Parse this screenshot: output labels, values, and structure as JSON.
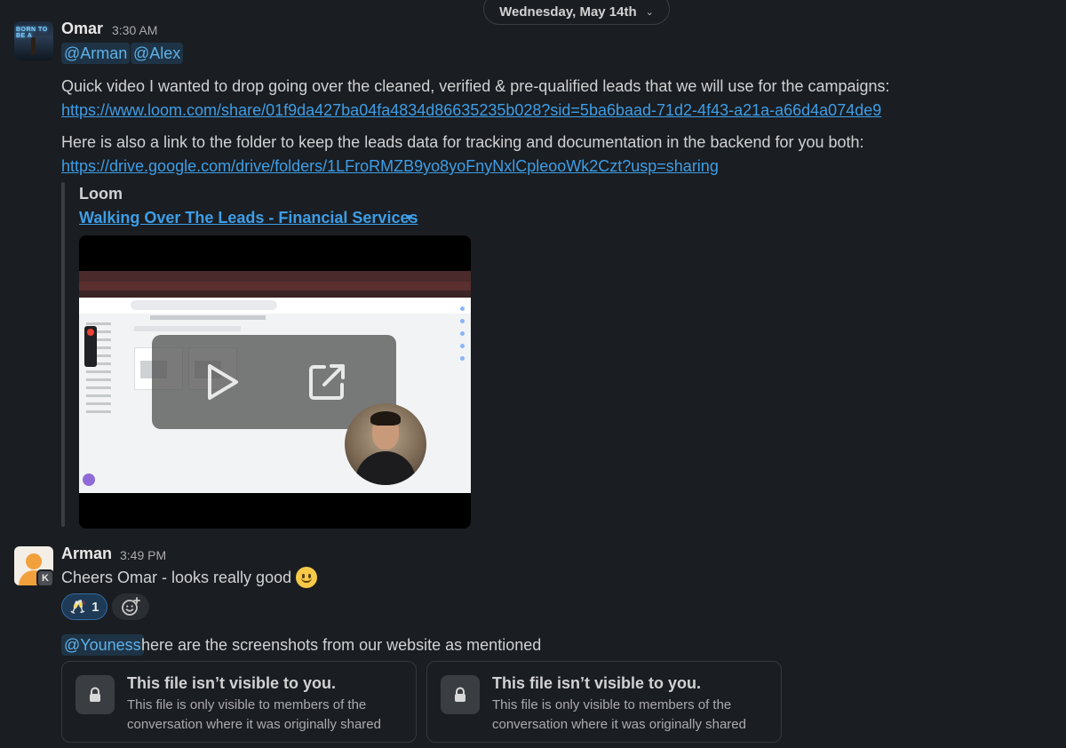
{
  "date_divider": {
    "label": "Wednesday, May 14th"
  },
  "messages": {
    "omar": {
      "name": "Omar",
      "time": "3:30 AM",
      "avatar_text": "BORN TO BE A",
      "mentions": [
        "@Arman",
        "@Alex"
      ],
      "line1": "Quick video I wanted to drop going over the cleaned, verified & pre-qualified leads that we will use for the campaigns:",
      "link1": "https://www.loom.com/share/01f9da427ba04fa4834d86635235b028?sid=5ba6baad-71d2-4f43-a21a-a66d4a074de9",
      "line2": "Here is also a link to the folder to keep the leads data for tracking and documentation in the backend for you both:",
      "link2": "https://drive.google.com/drive/folders/1LFroRMZB9yo8yoFnyNxlCpleooWk2Czt?usp=sharing",
      "unfurl": {
        "source": "Loom",
        "title": "Walking Over The Leads - Financial Services"
      }
    },
    "arman": {
      "name": "Arman",
      "time": "3:49 PM",
      "badge": "K",
      "text": "Cheers Omar - looks really good",
      "reaction": {
        "emoji": "🥂",
        "count": "1"
      },
      "mention": "@Youness",
      "text2": "here are the screenshots from our website as mentioned",
      "files": [
        {
          "title": "This file isn’t visible to you.",
          "subtitle": "This file is only visible to members of the conversation where it was originally shared"
        },
        {
          "title": "This file isn’t visible to you.",
          "subtitle": "This file is only visible to members of the conversation where it was originally shared"
        }
      ]
    }
  },
  "colors": {
    "background": "#1a1d21",
    "link": "#3d9ee8",
    "mention_bg": "#1e3446",
    "mention_text": "#5fb0e8"
  }
}
